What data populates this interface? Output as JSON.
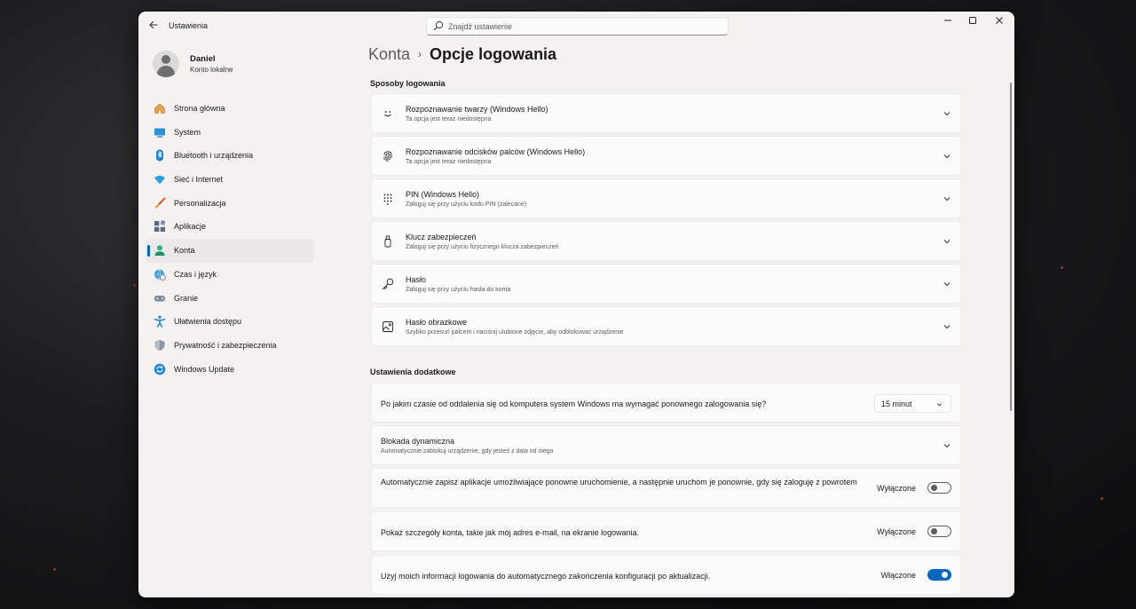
{
  "window": {
    "app_title": "Ustawienia",
    "search_placeholder": "Znajdź ustawienie"
  },
  "profile": {
    "name": "Daniel",
    "account_type": "Konto lokalne"
  },
  "sidebar": {
    "items": [
      {
        "label": "Strona główna",
        "icon": "home-icon"
      },
      {
        "label": "System",
        "icon": "system-icon"
      },
      {
        "label": "Bluetooth i urządzenia",
        "icon": "bluetooth-icon"
      },
      {
        "label": "Sieć i Internet",
        "icon": "wifi-icon"
      },
      {
        "label": "Personalizacja",
        "icon": "brush-icon"
      },
      {
        "label": "Aplikacje",
        "icon": "apps-icon"
      },
      {
        "label": "Konta",
        "icon": "accounts-icon",
        "active": true
      },
      {
        "label": "Czas i język",
        "icon": "globe-clock-icon"
      },
      {
        "label": "Granie",
        "icon": "gamepad-icon"
      },
      {
        "label": "Ułatwienia dostępu",
        "icon": "accessibility-icon"
      },
      {
        "label": "Prywatność i zabezpieczenia",
        "icon": "shield-icon"
      },
      {
        "label": "Windows Update",
        "icon": "update-icon"
      }
    ]
  },
  "breadcrumb": {
    "parent": "Konta",
    "separator": "›",
    "current": "Opcje logowania"
  },
  "sign_in_methods": {
    "title": "Sposoby logowania",
    "items": [
      {
        "title": "Rozpoznawanie twarzy (Windows Hello)",
        "subtitle": "Ta opcja jest teraz niedostępna",
        "icon": "face-icon"
      },
      {
        "title": "Rozpoznawanie odcisków palców (Windows Hello)",
        "subtitle": "Ta opcja jest teraz niedostępna",
        "icon": "fingerprint-icon"
      },
      {
        "title": "PIN (Windows Hello)",
        "subtitle": "Zaloguj się przy użyciu kodu PIN (zalecane)",
        "icon": "keypad-icon"
      },
      {
        "title": "Klucz zabezpieczeń",
        "subtitle": "Zaloguj się przy użyciu fizycznego klucza zabezpieczeń",
        "icon": "usb-key-icon"
      },
      {
        "title": "Hasło",
        "subtitle": "Zaloguj się przy użyciu hasła do konta",
        "icon": "key-icon"
      },
      {
        "title": "Hasło obrazkowe",
        "subtitle": "Szybko przesuń palcem i naciśnij ulubione zdjęcie, aby odblokować urządzenie",
        "icon": "picture-icon"
      }
    ]
  },
  "additional_settings": {
    "title": "Ustawienia dodatkowe",
    "require_signin": {
      "label": "Po jakim czasie od oddalenia się od komputera system Windows ma wymagać ponownego zalogowania się?",
      "value": "15 minut"
    },
    "dynamic_lock": {
      "title": "Blokada dynamiczna",
      "subtitle": "Automatycznie zablokuj urządzenie, gdy jesteś z dala od niego"
    },
    "restart_apps": {
      "label": "Automatycznie zapisz aplikacje umożliwiające ponowne uruchomienie, a następnie uruchom je ponownie, gdy się zaloguję z powrotem",
      "state": "Wyłączone",
      "on": false
    },
    "show_account_details": {
      "label": "Pokaż szczegóły konta, takie jak mój adres e-mail, na ekranie logowania.",
      "state": "Wyłączone",
      "on": false
    },
    "use_signin_info": {
      "label": "Użyj moich informacji logowania do automatycznego zakończenia konfiguracji po aktualizacji.",
      "state": "Włączone",
      "on": true
    }
  },
  "colors": {
    "accent": "#0067c0",
    "window_bg": "#f3f2f1",
    "card_bg": "#fbfbfb"
  }
}
